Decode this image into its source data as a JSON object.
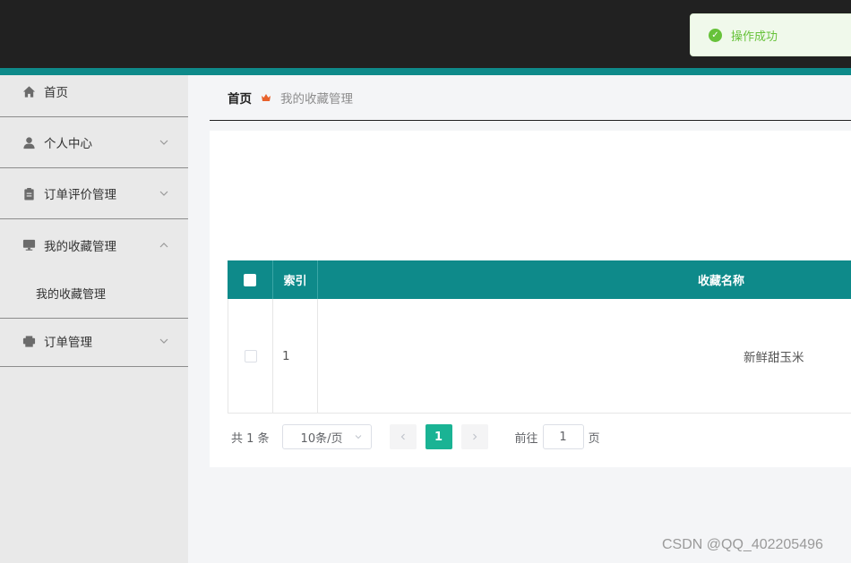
{
  "toast": {
    "message": "操作成功",
    "icon": "check-circle-icon",
    "color": "#67c23a"
  },
  "sidebar": {
    "items": [
      {
        "label": "首页",
        "icon": "home-icon"
      },
      {
        "label": "个人中心",
        "icon": "user-icon",
        "chevron": "down"
      },
      {
        "label": "订单评价管理",
        "icon": "clipboard-icon",
        "chevron": "down"
      },
      {
        "label": "我的收藏管理",
        "icon": "monitor-icon",
        "chevron": "up"
      },
      {
        "label": "订单管理",
        "icon": "printer-icon",
        "chevron": "down"
      }
    ],
    "submenu": {
      "label": "我的收藏管理"
    }
  },
  "breadcrumb": {
    "home": "首页",
    "current": "我的收藏管理",
    "separator_icon": "crown-icon"
  },
  "table": {
    "headers": {
      "index": "索引",
      "name": "收藏名称"
    },
    "rows": [
      {
        "index": "1",
        "name": "新鲜甜玉米"
      }
    ]
  },
  "pagination": {
    "total": "共 1 条",
    "page_size": "10条/页",
    "current_page": "1",
    "goto_prefix": "前往",
    "goto_value": "1",
    "goto_suffix": "页"
  },
  "watermark": "CSDN @QQ_402205496",
  "colors": {
    "header_bg": "#212121",
    "accent": "#0e8a8a",
    "page_active": "#1ab394"
  }
}
